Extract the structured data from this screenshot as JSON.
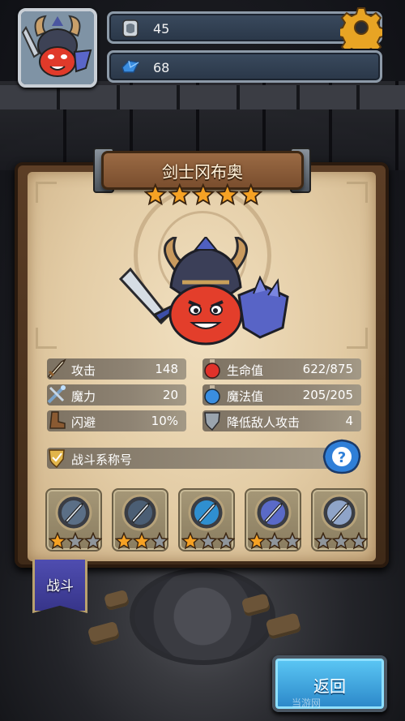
{
  "hud": {
    "resource_1": {
      "icon": "armor-token-icon",
      "value": "45"
    },
    "resource_2": {
      "icon": "blue-gem-icon",
      "value": "68"
    },
    "settings_icon": "gear-icon"
  },
  "hero": {
    "name": "剑士冈布奥",
    "stars": 5
  },
  "stats": {
    "attack": {
      "label": "攻击",
      "value": "148"
    },
    "magic": {
      "label": "魔力",
      "value": "20"
    },
    "dodge": {
      "label": "闪避",
      "value": "10%"
    },
    "hp": {
      "label": "生命值",
      "value": "622/875"
    },
    "mp": {
      "label": "魔法值",
      "value": "205/205"
    },
    "reduce_attack": {
      "label": "降低敌人攻击",
      "value": "4"
    }
  },
  "title_section": {
    "label": "战斗系称号",
    "help_icon": "question-icon"
  },
  "skills": [
    {
      "icon": "spear-medal-icon",
      "stars_filled": 1,
      "stars_total": 3
    },
    {
      "icon": "shield-spear-medal-icon",
      "stars_filled": 2,
      "stars_total": 3
    },
    {
      "icon": "blue-spear-medal-icon",
      "stars_filled": 1,
      "stars_total": 3
    },
    {
      "icon": "winged-sword-medal-icon",
      "stars_filled": 1,
      "stars_total": 3
    },
    {
      "icon": "crown-orb-medal-icon",
      "stars_filled": 0,
      "stars_total": 3
    }
  ],
  "tabs": {
    "battle": "战斗"
  },
  "buttons": {
    "back": "返回"
  },
  "watermark": "当游网",
  "colors": {
    "star_gold": "#f6a224",
    "star_gray": "#8f959b",
    "back_button": "#3fa8e6",
    "battle_tab": "#44429e"
  }
}
